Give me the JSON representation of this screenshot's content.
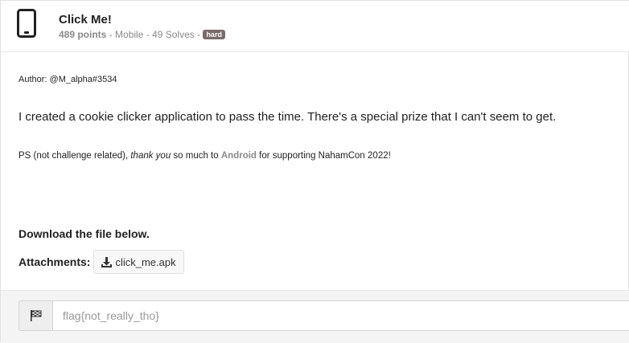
{
  "challenge": {
    "title": "Click Me!",
    "points": "489 points",
    "category": "Mobile",
    "solves": "49 Solves",
    "difficulty": "hard",
    "separator": " - ",
    "icon": "mobile-phone-icon"
  },
  "description": {
    "author": "Author: @M_alpha#3534",
    "text": "I created a cookie clicker application to pass the time. There's a special prize that I can't seem to get.",
    "ps_prefix": "PS (not challenge related), ",
    "ps_italic": "thank you",
    "ps_middle": " so much to ",
    "ps_sponsor": "Android",
    "ps_suffix": " for supporting NahamCon 2022!",
    "download": "Download the file below.",
    "attachments_label": "Attachments:",
    "attachment_file": "click_me.apk"
  },
  "flag_form": {
    "placeholder": "flag{not_really_tho}",
    "icon": "checkered-flag-icon"
  },
  "colors": {
    "badge": "#7a6a6a",
    "muted": "#8a8a8a",
    "text": "#222222"
  }
}
